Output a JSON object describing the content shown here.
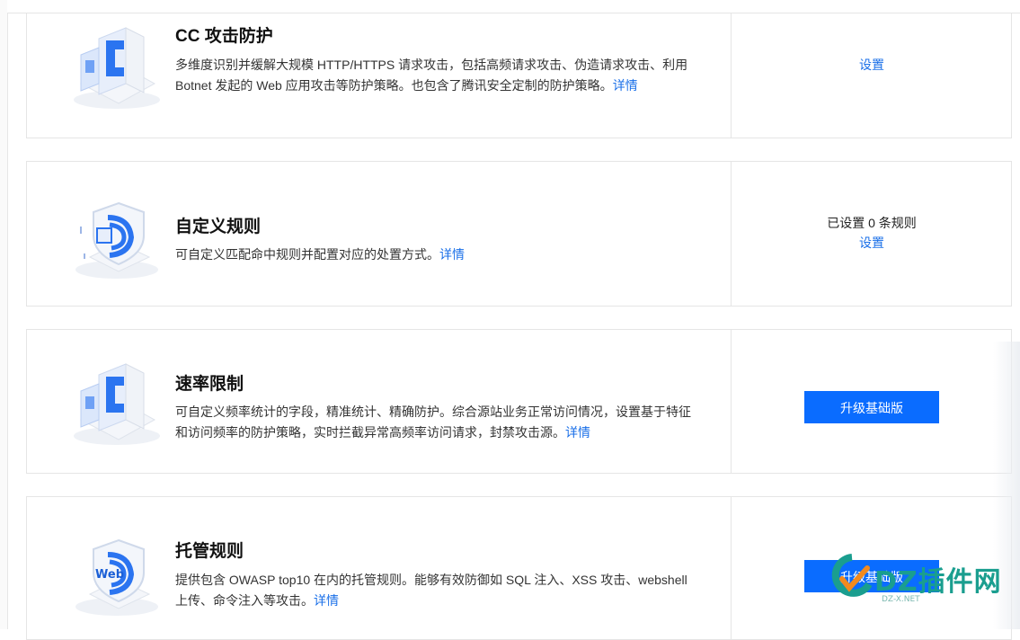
{
  "rules": [
    {
      "title": "CC 攻击防护",
      "desc": "多维度识别并缓解大规模 HTTP/HTTPS 请求攻击，包括高频请求攻击、伪造请求攻击、利用 Botnet 发起的 Web 应用攻击等防护策略。也包含了腾讯安全定制的防护策略。",
      "detail_label": "详情",
      "action_type": "link",
      "action_label": "设置"
    },
    {
      "title": "自定义规则",
      "desc": "可自定义匹配命中规则并配置对应的处置方式。",
      "detail_label": "详情",
      "action_type": "status-link",
      "status_text": "已设置 0 条规则",
      "action_label": "设置"
    },
    {
      "title": "速率限制",
      "desc": "可自定义频率统计的字段，精准统计、精确防护。综合源站业务正常访问情况，设置基于特征和访问频率的防护策略，实时拦截异常高频率访问请求，封禁攻击源。",
      "detail_label": "详情",
      "action_type": "button",
      "action_label": "升级基础版"
    },
    {
      "title": "托管规则",
      "desc": "提供包含 OWASP top10 在内的托管规则。能够有效防御如 SQL 注入、XSS 攻击、webshell 上传、命令注入等攻击。",
      "detail_label": "详情",
      "action_type": "button",
      "action_label": "升级基础版"
    }
  ],
  "illustrations": {
    "web_badge": "Web"
  },
  "watermark": {
    "name": "DZ插件网",
    "url": "DZ-X.NET"
  },
  "colors": {
    "accent": "#0a6cff",
    "link": "#1a6fe8",
    "border": "#e5e5e5",
    "watermark": "#1a9e8f"
  }
}
